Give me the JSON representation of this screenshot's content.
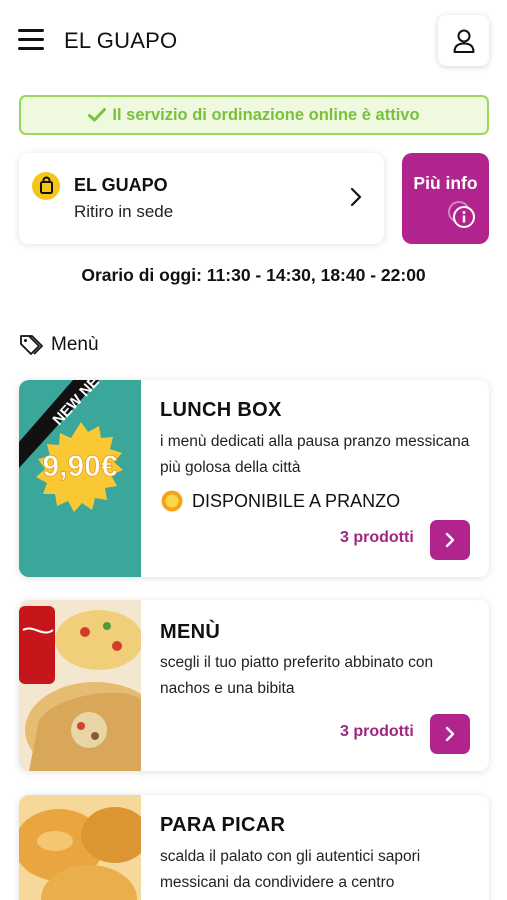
{
  "header": {
    "brand": "EL GUAPO",
    "menu_icon": "hamburger-icon",
    "user_icon": "user-icon"
  },
  "status": {
    "text": "Il servizio di ordinazione online è attivo",
    "icon": "check-icon",
    "color": "#79c13b"
  },
  "store": {
    "name": "EL GUAPO",
    "mode": "Ritiro in sede",
    "icon": "shopping-bag-icon"
  },
  "info_button": {
    "label": "Più info",
    "icon": "info-icon",
    "color": "#b2248d"
  },
  "hours": {
    "text": "Orario di oggi: 11:30 - 14:30, 18:40 - 22:00"
  },
  "menu_section": {
    "label": "Menù",
    "icon": "tag-icon"
  },
  "cards": [
    {
      "title": "LUNCH BOX",
      "description": "i menù dedicati alla pausa pranzo messicana più golosa della città",
      "availability": "DISPONIBILE A PRANZO",
      "availability_icon": "sun-icon",
      "count": "3 prodotti",
      "badge_ribbon": "NEW NEW",
      "badge_price": "9,90€"
    },
    {
      "title": "MENÙ",
      "description": "scegli il tuo piatto preferito abbinato con nachos e una bibita",
      "count": "3 prodotti"
    },
    {
      "title": "PARA PICAR",
      "description": "scalda il palato con gli autentici sapori messicani da condividere a centro"
    }
  ]
}
